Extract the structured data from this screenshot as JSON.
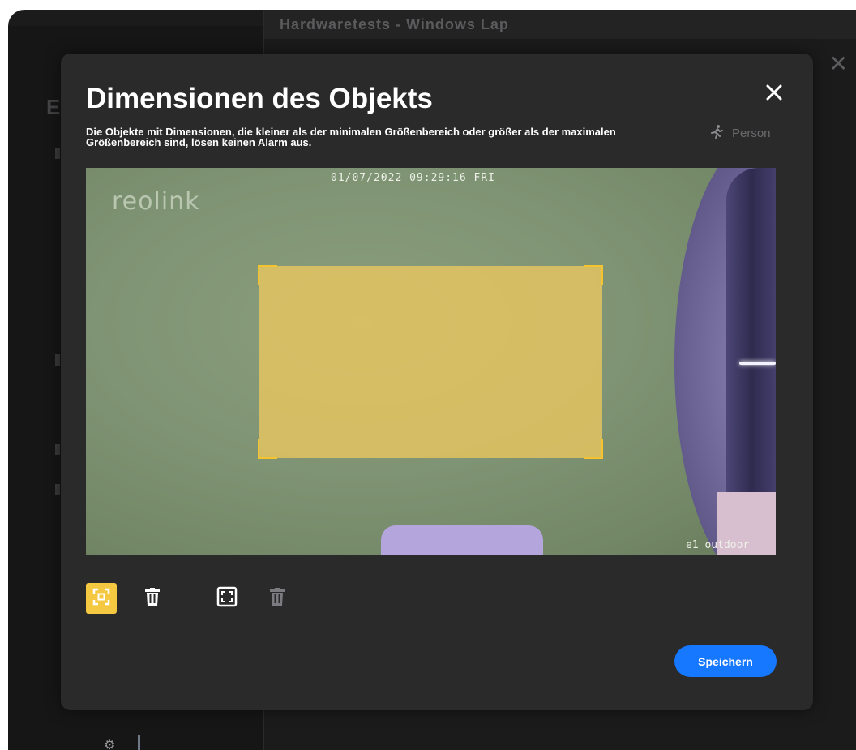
{
  "background": {
    "window_title": "Hardwaretests - Windows Lap",
    "section_letter": "E"
  },
  "modal": {
    "title": "Dimensionen des Objekts",
    "description": "Die Objekte mit Dimensionen, die kleiner als der minimalen Größenbereich oder größer als der maximalen Größenbereich sind, lösen keinen Alarm aus.",
    "filter_label": "Person"
  },
  "preview": {
    "timestamp": "01/07/2022 09:29:16 FRI",
    "logo": "reolink",
    "camera_name": "e1 outdoor"
  },
  "toolbar": {
    "tools": [
      {
        "name": "select-min-size-icon",
        "active": true
      },
      {
        "name": "delete-min-size-icon",
        "active": false
      },
      {
        "name": "select-max-size-icon",
        "active": false
      },
      {
        "name": "delete-max-size-icon",
        "active": false,
        "disabled": true
      }
    ]
  },
  "actions": {
    "save_label": "Speichern"
  },
  "colors": {
    "accent": "#1677ff",
    "selection": "#f5c842",
    "modal_bg": "#2a2a2b"
  }
}
